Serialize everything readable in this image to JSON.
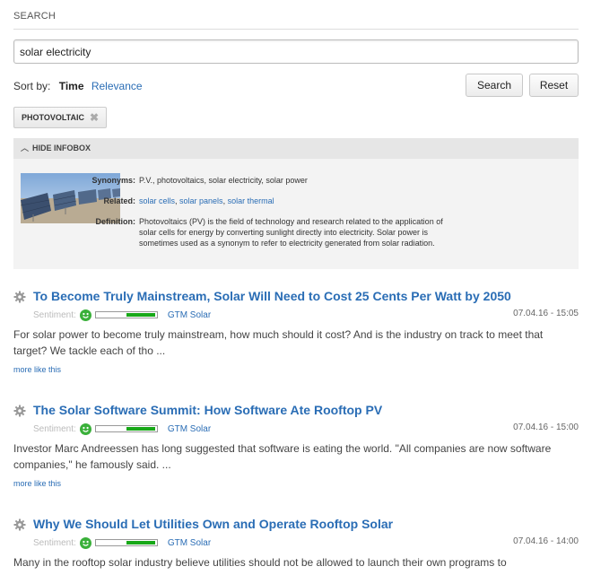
{
  "search": {
    "header": "SEARCH",
    "query": "solar electricity",
    "sort_label": "Sort by:",
    "sort_options": [
      "Time",
      "Relevance"
    ],
    "search_button": "Search",
    "reset_button": "Reset"
  },
  "filters": [
    {
      "label": "PHOTOVOLTAIC"
    }
  ],
  "infobox": {
    "toggle_label": "HIDE INFOBOX",
    "synonyms_key": "Synonyms:",
    "synonyms": "P.V., photovoltaics, solar electricity, solar power",
    "related_key": "Related:",
    "related": [
      "solar cells",
      "solar panels",
      "solar thermal"
    ],
    "definition_key": "Definition:",
    "definition_lines": [
      "Photovoltaics (PV) is the field of technology and research related to the application of",
      "solar cells for energy by converting sunlight directly into electricity. Solar power is",
      "sometimes used as a synonym to refer to electricity generated from solar radiation."
    ]
  },
  "results": [
    {
      "title": "To Become Truly Mainstream, Solar Will Need to Cost 25 Cents Per Watt by 2050",
      "sentiment_label": "Sentiment:",
      "sentiment": 0.5,
      "source": "GTM Solar",
      "date": "07.04.16 - 15:05",
      "snippet": "For solar power to become truly mainstream, how much should it cost? And is the industry on track to meet that target? We tackle each of tho ...",
      "more": "more like this"
    },
    {
      "title": "The Solar Software Summit: How Software Ate Rooftop PV",
      "sentiment_label": "Sentiment:",
      "sentiment": 0.5,
      "source": "GTM Solar",
      "date": "07.04.16 - 15:00",
      "snippet": "Investor Marc Andreessen has long suggested that software is eating the world. \"All companies are now software companies,\" he famously said. ...",
      "more": "more like this"
    },
    {
      "title": "Why We Should Let Utilities Own and Operate Rooftop Solar",
      "sentiment_label": "Sentiment:",
      "sentiment": 0.5,
      "source": "GTM Solar",
      "date": "07.04.16 - 14:00",
      "snippet": "Many in the rooftop solar industry believe utilities should not be allowed to launch their own programs to",
      "more": ""
    }
  ],
  "colors": {
    "link": "#2a6db5",
    "sentiment_fill": "#18a818",
    "smiley": "#3ab03a"
  },
  "icons": {
    "result": "gear-icon",
    "remove": "close-icon",
    "collapse": "chevron-up-icon",
    "sentiment": "smiley-icon"
  }
}
